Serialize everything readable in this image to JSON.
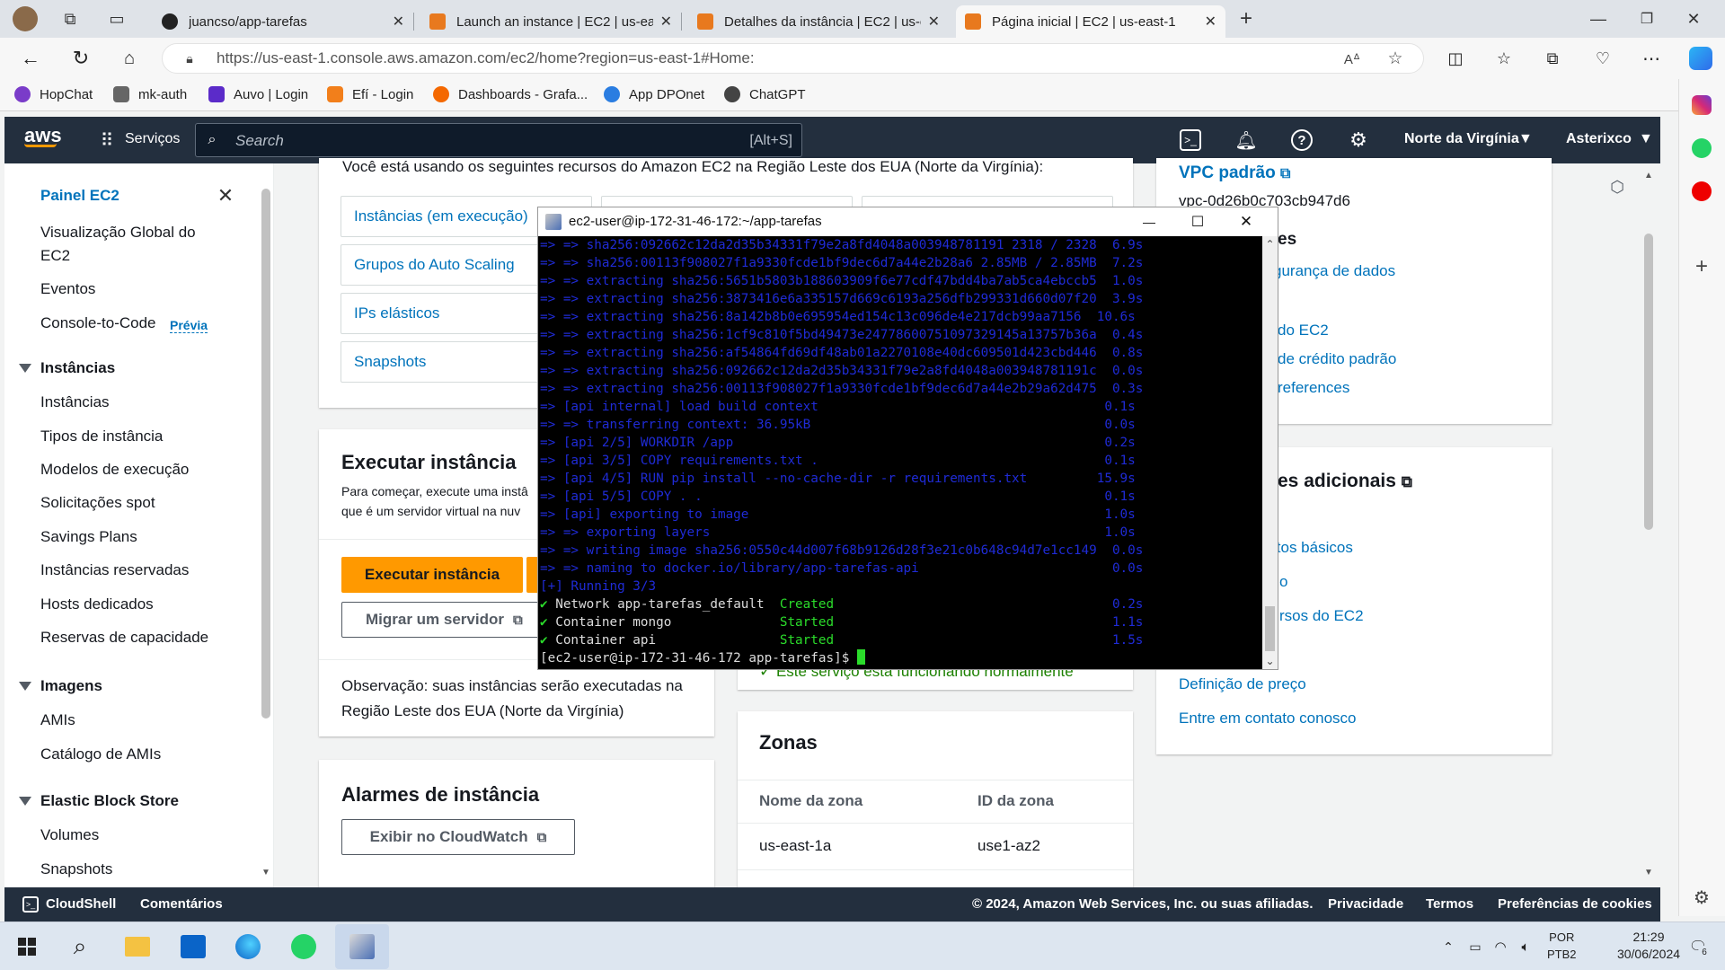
{
  "browser": {
    "tabs": [
      {
        "title": "juancso/app-tarefas"
      },
      {
        "title": "Launch an instance | EC2 | us-eas"
      },
      {
        "title": "Detalhes da instância | EC2 | us-e"
      },
      {
        "title": "Página inicial | EC2 | us-east-1"
      }
    ],
    "url": "https://us-east-1.console.aws.amazon.com/ec2/home?region=us-east-1#Home:",
    "bookmarks": [
      "HopChat",
      "mk-auth",
      "Auvo | Login",
      "Efí - Login",
      "Dashboards - Grafa...",
      "App DPOnet",
      "ChatGPT"
    ]
  },
  "aws": {
    "logo": "aws",
    "services": "Serviços",
    "search_placeholder": "Search",
    "search_shortcut": "[Alt+S]",
    "region": "Norte da Virgínia",
    "account": "Asterixco"
  },
  "sidenav": {
    "title": "Painel EC2",
    "items_top": [
      "Visualização Global do EC2",
      "Eventos"
    ],
    "console_to_code": "Console-to-Code",
    "preview_badge": "Prévia",
    "sections": [
      {
        "header": "Instâncias",
        "items": [
          "Instâncias",
          "Tipos de instância",
          "Modelos de execução",
          "Solicitações spot",
          "Savings Plans",
          "Instâncias reservadas",
          "Hosts dedicados",
          "Reservas de capacidade"
        ]
      },
      {
        "header": "Imagens",
        "items": [
          "AMIs",
          "Catálogo de AMIs"
        ]
      },
      {
        "header": "Elastic Block Store",
        "items": [
          "Volumes",
          "Snapshots"
        ]
      }
    ]
  },
  "main": {
    "resources_intro": "Você está usando os seguintes recursos do Amazon EC2 na Região Leste dos EUA (Norte da Virgínia):",
    "resources": [
      "Instâncias (em execução)",
      "Grupos do Auto Scaling",
      "IPs elásticos",
      "Snapshots"
    ],
    "launch": {
      "title": "Executar instância",
      "desc_1": "Para começar, execute uma instâ",
      "desc_2": "que é um servidor virtual na nuv",
      "launch_button": "Executar instância",
      "migrate_button": "Migrar um servidor",
      "note": "Observação: suas instâncias serão executadas na Região Leste dos EUA (Norte da Virgínia)"
    },
    "alarms": {
      "title": "Alarmes de instância",
      "cloudwatch_button": "Exibir no CloudWatch"
    },
    "service_status": "Este serviço está funcionando normalmente",
    "zones": {
      "title": "Zonas",
      "columns": [
        "Nome da zona",
        "ID da zona"
      ],
      "rows": [
        [
          "us-east-1a",
          "use1-az2"
        ]
      ]
    },
    "right": {
      "vpc_title": "VPC padrão",
      "vpc_id": "vpc-0d26b0c703cb947d6",
      "attrs_title_partial": "es",
      "attrs_links": [
        "gurança de dados",
        "do EC2",
        "de crédito padrão",
        "references"
      ],
      "info_title_partial": "es adicionais",
      "info_links": [
        "itos básicos",
        "o",
        "rsos do EC2",
        "Definição de preço",
        "Entre em contato conosco"
      ]
    }
  },
  "terminal": {
    "title": "ec2-user@ip-172-31-46-172:~/app-tarefas",
    "lines": [
      {
        "c": "blue",
        "t": "=> => sha256:092662c12da2d35b34331f79e2a8fd4048a003948781191 2318 / 2328  6.9s"
      },
      {
        "c": "blue",
        "t": "=> => sha256:00113f908027f1a9330fcde1bf9dec6d7a44e2b28a6 2.85MB / 2.85MB  7.2s"
      },
      {
        "c": "blue",
        "t": "=> => extracting sha256:5651b5803b188603909f6e77cdf47bdd4ba7ab5ca4ebccb5  1.0s"
      },
      {
        "c": "blue",
        "t": "=> => extracting sha256:3873416e6a335157d669c6193a256dfb299331d660d07f20  3.9s"
      },
      {
        "c": "blue",
        "t": "=> => extracting sha256:8a142b8b0e695954ed154c13c096de4e217dcb99aa7156  10.6s"
      },
      {
        "c": "blue",
        "t": "=> => extracting sha256:1cf9c810f5bd49473e24778600751097329145a13757b36a  0.4s"
      },
      {
        "c": "blue",
        "t": "=> => extracting sha256:af54864fd69df48ab01a2270108e40dc609501d423cbd446  0.8s"
      },
      {
        "c": "blue",
        "t": "=> => extracting sha256:092662c12da2d35b34331f79e2a8fd4048a003948781191c  0.0s"
      },
      {
        "c": "blue",
        "t": "=> => extracting sha256:00113f908027f1a9330fcde1bf9dec6d7a44e2b29a62d475  0.3s"
      },
      {
        "c": "blue",
        "t": "=> [api internal] load build context                                     0.1s"
      },
      {
        "c": "blue",
        "t": "=> => transferring context: 36.95kB                                      0.0s"
      },
      {
        "c": "blue",
        "t": "=> [api 2/5] WORKDIR /app                                                0.2s"
      },
      {
        "c": "blue",
        "t": "=> [api 3/5] COPY requirements.txt .                                     0.1s"
      },
      {
        "c": "blue",
        "t": "=> [api 4/5] RUN pip install --no-cache-dir -r requirements.txt         15.9s"
      },
      {
        "c": "blue",
        "t": "=> [api 5/5] COPY . .                                                    0.1s"
      },
      {
        "c": "blue",
        "t": "=> [api] exporting to image                                              1.0s"
      },
      {
        "c": "blue",
        "t": "=> => exporting layers                                                   1.0s"
      },
      {
        "c": "blue",
        "t": "=> => writing image sha256:0550c44d007f68b9126d28f3e21c0b648c94d7e1cc149  0.0s"
      },
      {
        "c": "blue",
        "t": "=> => naming to docker.io/library/app-tarefas-api                         0.0s"
      },
      {
        "c": "blue",
        "t": "[+] Running 3/3"
      }
    ],
    "status_lines": [
      {
        "name": " Network app-tarefas_default  ",
        "state": "Created",
        "time": "0.2s"
      },
      {
        "name": " Container mongo              ",
        "state": "Started",
        "time": "1.1s"
      },
      {
        "name": " Container api                ",
        "state": "Started",
        "time": "1.5s"
      }
    ],
    "prompt": "[ec2-user@ip-172-31-46-172 app-tarefas]$ "
  },
  "footer": {
    "cloudshell": "CloudShell",
    "feedback": "Comentários",
    "copyright": "© 2024, Amazon Web Services, Inc. ou suas afiliadas.",
    "privacy": "Privacidade",
    "terms": "Termos",
    "cookies": "Preferências de cookies"
  },
  "taskbar": {
    "lang_1": "POR",
    "lang_2": "PTB2",
    "time": "21:29",
    "date": "30/06/2024",
    "notif_count": "6"
  },
  "colors": {
    "aws_dark": "#232f3e",
    "aws_orange": "#ff9900",
    "link": "#0073bb",
    "term_blue": "#1f2bd6",
    "term_green": "#2bdc2b"
  }
}
